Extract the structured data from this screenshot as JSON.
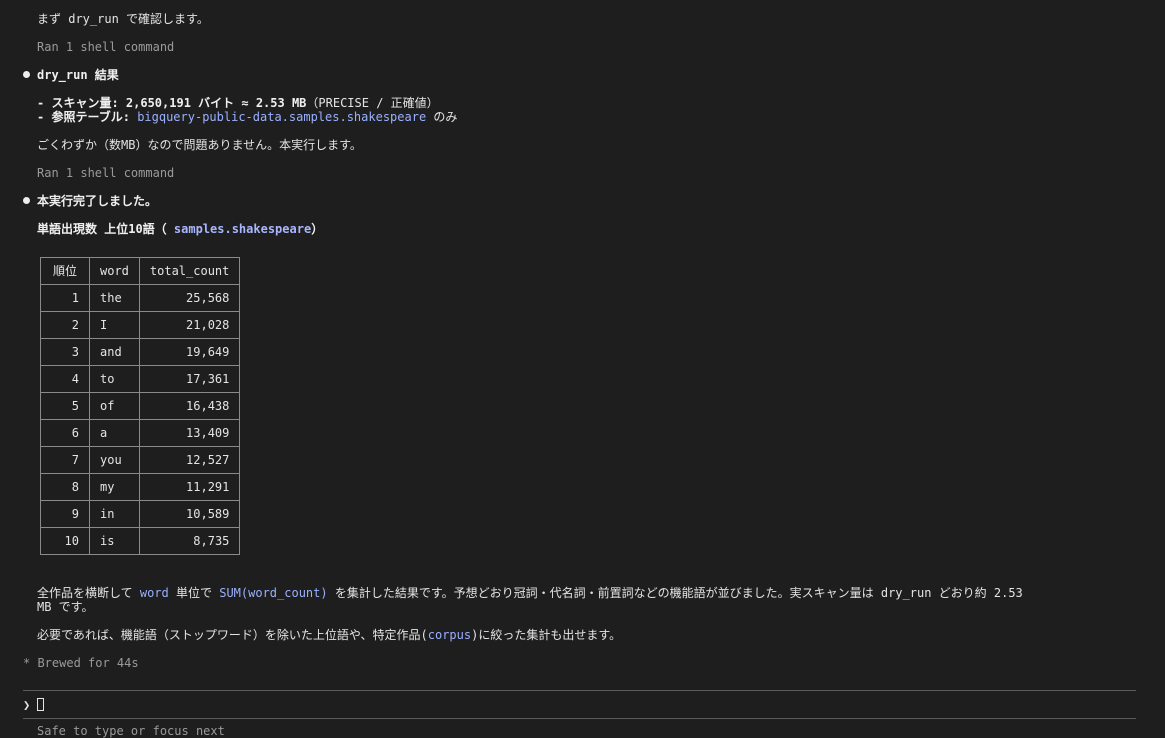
{
  "messages": {
    "intro": "まず dry_run で確認します。",
    "ran_cmd_1": "Ran 1 shell command",
    "dry_run_heading": "dry_run 結果",
    "scan_prefix": "- スキャン量: ",
    "scan_value": "2,650,191 バイト ≈ 2.53 MB",
    "scan_suffix": "（PRECISE / 正確値）",
    "ref_prefix": "- 参照テーブル: ",
    "ref_table": "bigquery-public-data.samples.shakespeare",
    "ref_suffix": " のみ",
    "ok_note": "ごくわずか（数MB）なので問題ありません。本実行します。",
    "ran_cmd_2": "Ran 1 shell command",
    "done_heading": "本実行完了しました。",
    "table_title_prefix": "単語出現数 上位10語（ ",
    "table_title_code": "samples.shakespeare",
    "table_title_suffix": "）",
    "summary_1a": "全作品を横断して ",
    "summary_1_code1": "word",
    "summary_1b": " 単位で ",
    "summary_1_code2": "SUM(word_count)",
    "summary_1c": " を集計した結果です。予想どおり冠詞・代名詞・前置詞などの機能語が並びました。実スキャン量は dry_run どおり約 2.53",
    "summary_2": "MB です。",
    "followup_a": "必要であれば、機能語（ストップワード）を除いた上位語や、特定作品(",
    "followup_code": "corpus",
    "followup_b": ")に絞った集計も出せます。",
    "status": "* Brewed for 44s",
    "prompt_symbol": "❯",
    "footer_partial": "Safe to type or focus next"
  },
  "table": {
    "headers": [
      "順位",
      "word",
      "total_count"
    ],
    "rows": [
      [
        "1",
        "the",
        "25,568"
      ],
      [
        "2",
        "I",
        "21,028"
      ],
      [
        "3",
        "and",
        "19,649"
      ],
      [
        "4",
        "to",
        "17,361"
      ],
      [
        "5",
        "of",
        "16,438"
      ],
      [
        "6",
        "a",
        "13,409"
      ],
      [
        "7",
        "you",
        "12,527"
      ],
      [
        "8",
        "my",
        "11,291"
      ],
      [
        "9",
        "in",
        "10,589"
      ],
      [
        "10",
        "is",
        "8,735"
      ]
    ]
  }
}
